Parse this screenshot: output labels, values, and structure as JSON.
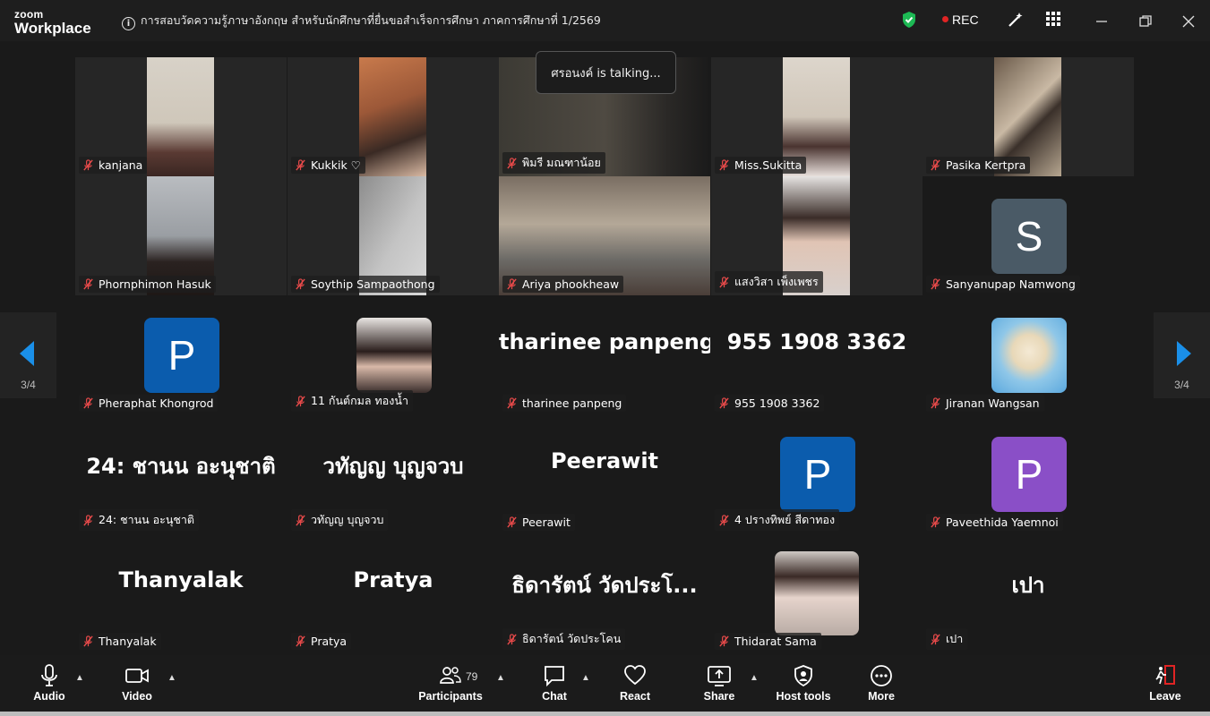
{
  "app": {
    "logo_top": "zoom",
    "logo_bottom": "Workplace"
  },
  "meeting": {
    "title": "การสอบวัดความรู้ภาษาอังกฤษ สำหรับนักศึกษาที่ยื่นขอสำเร็จการศึกษา ภาคการศึกษาที่ 1/2569",
    "rec_label": "REC",
    "talking": "ศรอนงค์ is talking..."
  },
  "pager": {
    "left_label": "3/4",
    "right_label": "3/4"
  },
  "tiles": [
    {
      "name": "kanjana"
    },
    {
      "name": "Kukkik ♡"
    },
    {
      "name": "พิมรี มณฑาน้อย"
    },
    {
      "name": "Miss.Sukitta"
    },
    {
      "name": "Pasika Kertpra"
    },
    {
      "name": "Phornphimon Hasuk"
    },
    {
      "name": "Soythip Sampaothong"
    },
    {
      "name": "Ariya phookheaw"
    },
    {
      "name": "แสงวิสา เพ็งเพชร"
    },
    {
      "name": "Sanyanupap Namwong",
      "initial": "S",
      "avatar_color": "#4a5a66"
    },
    {
      "name": "Pheraphat Khongrod",
      "initial": "P",
      "avatar_color": "#0b5cad"
    },
    {
      "name": "11 กันต์กมล ทองน้ำ"
    },
    {
      "name": "tharinee panpeng",
      "display": "tharinee panpeng"
    },
    {
      "name": "955 1908 3362",
      "display": "955 1908 3362"
    },
    {
      "name": "Jiranan Wangsan"
    },
    {
      "name": "24: ชานน อะนุชาติ",
      "display": "24: ชานน อะนุชาติ"
    },
    {
      "name": "วทัญญ บุญจวบ",
      "display": "วทัญญ บุญจวบ"
    },
    {
      "name": "Peerawit",
      "display": "Peerawit"
    },
    {
      "name": "4 ปรางทิพย์ สีดาทอง",
      "initial": "P",
      "avatar_color": "#0b5cad"
    },
    {
      "name": "Paveethida Yaemnoi",
      "initial": "P",
      "avatar_color": "#8a4fc7"
    },
    {
      "name": "Thanyalak",
      "display": "Thanyalak"
    },
    {
      "name": "Pratya",
      "display": "Pratya"
    },
    {
      "name": "ธิดารัตน์ วัดประโคน",
      "display": "ธิดารัตน์ วัดประโ..."
    },
    {
      "name": "Thidarat Sama"
    },
    {
      "name": "เปา",
      "display": "เปา"
    }
  ],
  "toolbar": {
    "audio": "Audio",
    "video": "Video",
    "participants": "Participants",
    "participants_count": "79",
    "chat": "Chat",
    "react": "React",
    "share": "Share",
    "host_tools": "Host tools",
    "more": "More",
    "leave": "Leave"
  },
  "colors": {
    "accent": "#1a8fe8",
    "leave": "#e02424",
    "shield": "#1db954"
  }
}
